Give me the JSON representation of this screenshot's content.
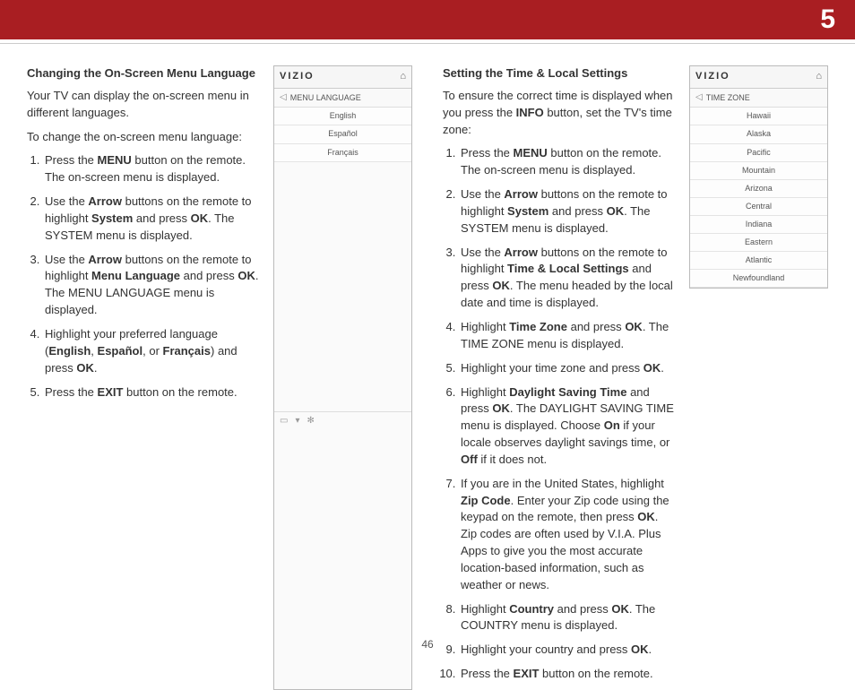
{
  "chapter": "5",
  "pageNumber": "46",
  "left": {
    "heading": "Changing the On-Screen Menu Language",
    "intro1": "Your TV can display the on-screen menu in different languages.",
    "intro2": "To change the on-screen menu language:",
    "s1a": "Press the ",
    "s1b": "MENU",
    "s1c": " button on the remote. The on-screen menu is displayed.",
    "s2a": "Use the ",
    "s2b": "Arrow",
    "s2c": " buttons on the remote to highlight ",
    "s2d": "System",
    "s2e": " and press ",
    "s2f": "OK",
    "s2g": ". The SYSTEM menu is displayed.",
    "s3a": "Use the ",
    "s3b": "Arrow",
    "s3c": " buttons on the remote to highlight ",
    "s3d": "Menu Language",
    "s3e": " and press ",
    "s3f": "OK",
    "s3g": ". The MENU LANGUAGE menu is displayed.",
    "s4a": "Highlight your preferred language (",
    "s4b": "English",
    "s4c": ", ",
    "s4d": "Español",
    "s4e": ", or ",
    "s4f": "Français",
    "s4g": ") and press ",
    "s4h": "OK",
    "s4i": ".",
    "s5a": "Press the ",
    "s5b": "EXIT",
    "s5c": " button on the remote.",
    "menu": {
      "logo": "VIZIO",
      "title": "MENU LANGUAGE",
      "items": [
        "English",
        "Español",
        "Français"
      ]
    }
  },
  "right": {
    "heading": "Setting the Time & Local Settings",
    "intro1a": "To ensure the correct time is displayed when you press the ",
    "intro1b": "INFO",
    "intro1c": " button, set the TV's time zone:",
    "s1a": "Press the ",
    "s1b": "MENU",
    "s1c": " button on the remote. The on-screen menu is displayed.",
    "s2a": "Use the ",
    "s2b": "Arrow",
    "s2c": " buttons on the remote to highlight ",
    "s2d": "System",
    "s2e": " and press ",
    "s2f": "OK",
    "s2g": ". The SYSTEM menu is displayed.",
    "s3a": "Use the ",
    "s3b": "Arrow",
    "s3c": " buttons on the remote to highlight ",
    "s3d": "Time & Local Settings",
    "s3e": " and press ",
    "s3f": "OK",
    "s3g": ". The menu headed by the local date and time is displayed.",
    "s4a": "Highlight ",
    "s4b": "Time Zone",
    "s4c": " and press ",
    "s4d": "OK",
    "s4e": ". The TIME ZONE menu is displayed.",
    "s5a": "Highlight your time zone and press ",
    "s5b": "OK",
    "s5c": ".",
    "s6a": "Highlight ",
    "s6b": "Daylight Saving Time",
    "s6c": " and press ",
    "s6d": "OK",
    "s6e": ". The DAYLIGHT SAVING TIME menu is displayed. Choose ",
    "s6f": "On",
    "s6g": " if your locale observes daylight savings time, or ",
    "s6h": "Off",
    "s6i": " if it does not.",
    "s7a": "If you are in the United States, highlight ",
    "s7b": "Zip Code",
    "s7c": ". Enter your Zip code using the keypad on the remote, then press ",
    "s7d": "OK",
    "s7e": ". Zip codes are often used by V.I.A. Plus Apps to give you the most accurate location-based information, such as weather or news.",
    "s8a": "Highlight ",
    "s8b": "Country",
    "s8c": " and press ",
    "s8d": "OK",
    "s8e": ". The COUNTRY menu is displayed.",
    "s9a": "Highlight your country and press ",
    "s9b": "OK",
    "s9c": ".",
    "s10a": "Press the ",
    "s10b": "EXIT",
    "s10c": " button on the remote.",
    "menu": {
      "logo": "VIZIO",
      "title": "TIME ZONE",
      "items": [
        "Hawaii",
        "Alaska",
        "Pacific",
        "Mountain",
        "Arizona",
        "Central",
        "Indiana",
        "Eastern",
        "Atlantic",
        "Newfoundland"
      ]
    }
  }
}
